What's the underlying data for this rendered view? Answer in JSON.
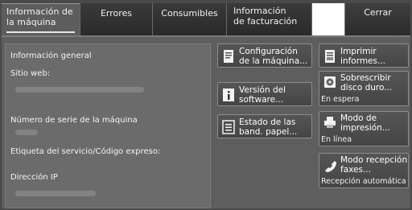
{
  "tabs": [
    {
      "label": "Información de\nla máquina",
      "active": true
    },
    {
      "label": "Errores",
      "active": false
    },
    {
      "label": "Consumibles",
      "active": false
    },
    {
      "label": "Información\nde facturación",
      "active": false
    }
  ],
  "close_label": "Cerrar",
  "info": {
    "general": "Información general",
    "website": "Sitio web:",
    "serial": "Número de serie de la máquina",
    "service_label": "Etiqueta del servicio/Código expreso:",
    "ip": "Dirección IP"
  },
  "buttons": {
    "machine_config": "Configuración\nde la máquina...",
    "software_version": "Versión del\nsoftware...",
    "tray_status": "Estado de las\nband. papel...",
    "print_reports": "Imprimir\ninformes...",
    "overwrite_disk": "Sobrescribir\ndisco duro...",
    "overwrite_status": "En espera",
    "print_mode": "Modo de\nimpresión...",
    "print_mode_status": "En línea",
    "fax_mode": "Modo recepción\nfaxes...",
    "fax_mode_status": "Recepción automática"
  },
  "icons": {
    "machine_config": "document-icon",
    "software_version": "info-icon",
    "tray_status": "list-icon",
    "print_reports": "report-icon",
    "overwrite_disk": "disk-icon",
    "print_mode": "printer-icon",
    "fax_mode": "phone-icon"
  }
}
